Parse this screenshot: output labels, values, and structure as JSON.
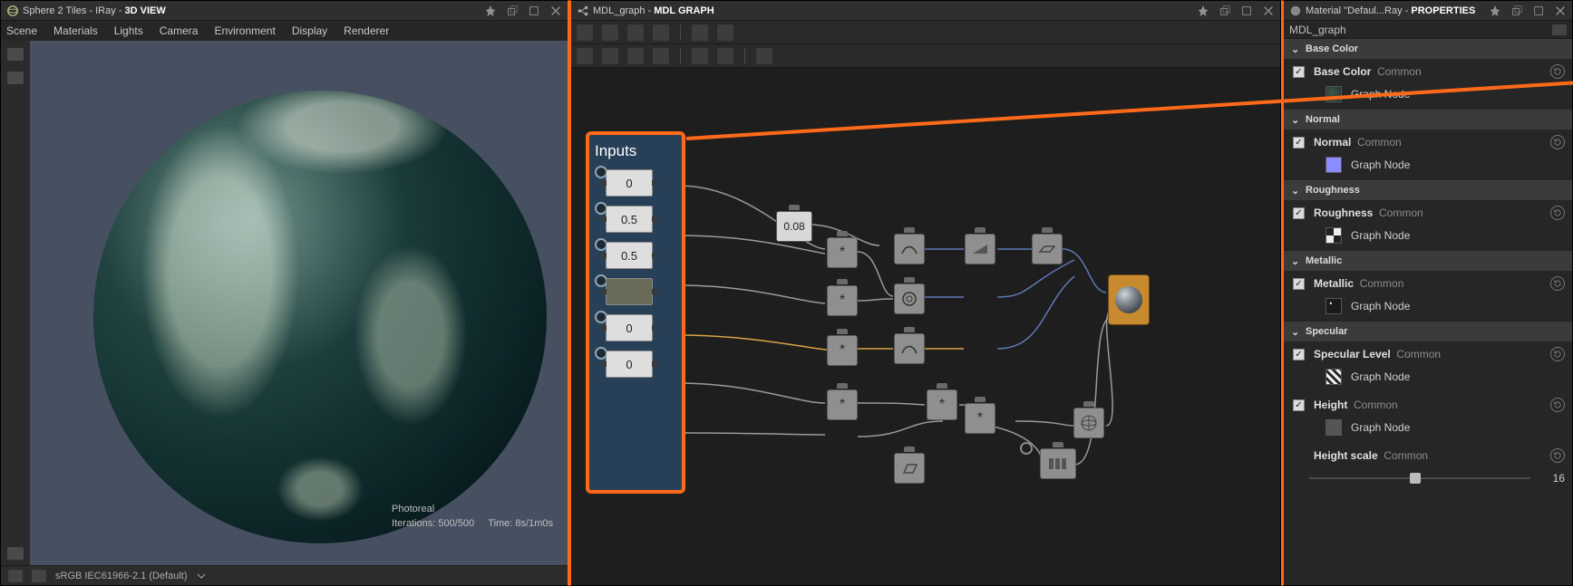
{
  "left": {
    "title_prefix": "Sphere 2 Tiles - IRay -",
    "title_suffix": "3D VIEW",
    "menu": [
      "Scene",
      "Materials",
      "Lights",
      "Camera",
      "Environment",
      "Display",
      "Renderer"
    ],
    "stats": {
      "mode": "Photoreal",
      "iterations": "Iterations: 500/500",
      "time": "Time: 8s/1m0s"
    },
    "status": "sRGB IEC61966-2.1 (Default)"
  },
  "mid": {
    "title_prefix": "MDL_graph -",
    "title_suffix": "MDL GRAPH",
    "inputs_label": "Inputs",
    "inputs": [
      "0",
      "0.5",
      "0.5",
      "",
      "0",
      "0"
    ],
    "const": "0.08"
  },
  "right": {
    "title_prefix": "Material \"Defaul...Ray -",
    "title_suffix": "PROPERTIES",
    "sub": "MDL_graph",
    "sections": [
      {
        "name": "Base Color",
        "items": [
          {
            "label": "Base Color",
            "common": "Common",
            "node": "Graph Node"
          }
        ]
      },
      {
        "name": "Normal",
        "items": [
          {
            "label": "Normal",
            "common": "Common",
            "node": "Graph Node"
          }
        ]
      },
      {
        "name": "Roughness",
        "items": [
          {
            "label": "Roughness",
            "common": "Common",
            "node": "Graph Node"
          }
        ]
      },
      {
        "name": "Metallic",
        "items": [
          {
            "label": "Metallic",
            "common": "Common",
            "node": "Graph Node"
          }
        ]
      },
      {
        "name": "Specular",
        "items": [
          {
            "label": "Specular Level",
            "common": "Common",
            "node": "Graph Node"
          },
          {
            "label": "Height",
            "common": "Common",
            "node": "Graph Node"
          },
          {
            "label": "Height scale",
            "common": "Common",
            "slider": true,
            "value": "16"
          }
        ]
      }
    ]
  }
}
